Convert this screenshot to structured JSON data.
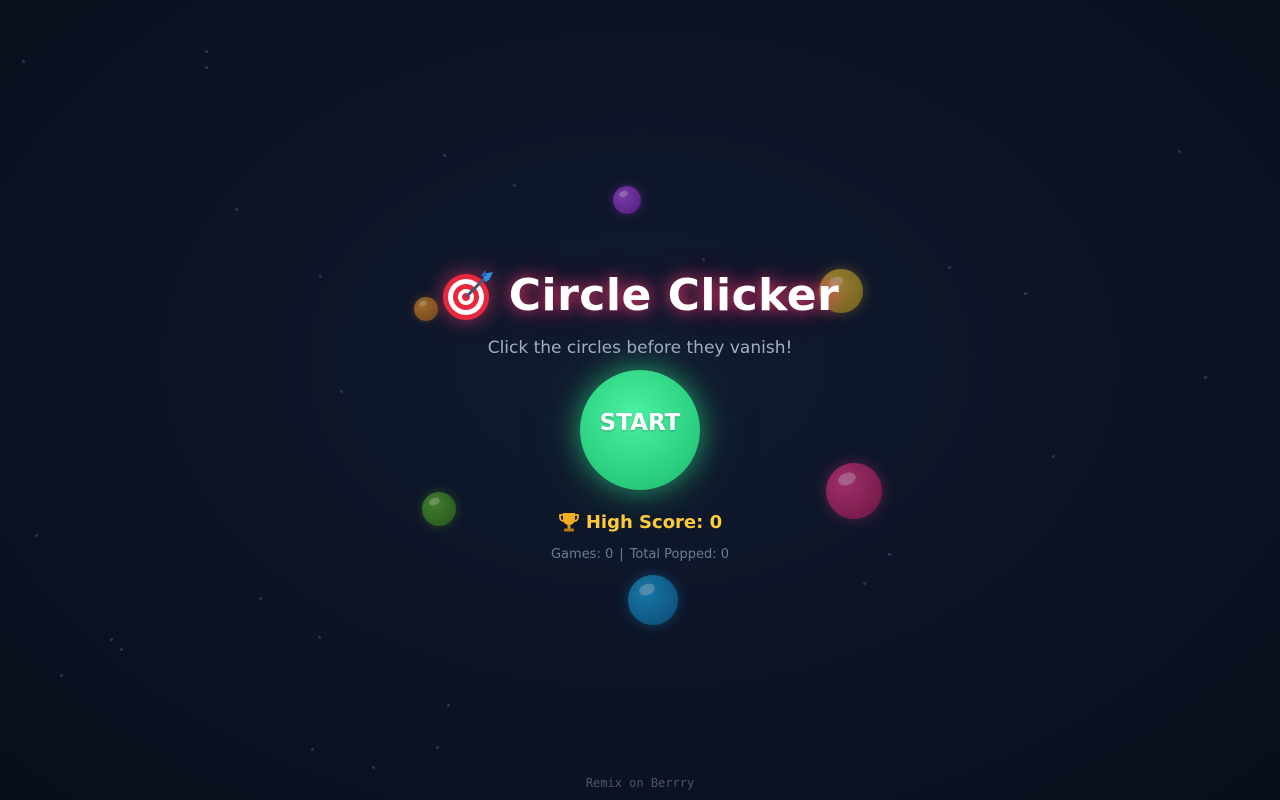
{
  "title": "Circle Clicker",
  "title_icon": "dart-target-icon",
  "subtitle": "Click the circles before they vanish!",
  "start_button": "START",
  "high_score": {
    "icon": "trophy-icon",
    "label": "High Score: 0"
  },
  "stats": {
    "games": "Games: 0",
    "separator": "|",
    "total_popped": "Total Popped: 0"
  },
  "footer": "Remix on Berrry",
  "colors": {
    "background": "#0c1324",
    "start_button": "#2fd585",
    "title_glow": "#ff3c78",
    "high_score": "#ffcb3b",
    "bubbles": [
      "#a248d8",
      "#d5892a",
      "#cdb236",
      "#55a531",
      "#d93a82",
      "#1c9bd8"
    ]
  }
}
